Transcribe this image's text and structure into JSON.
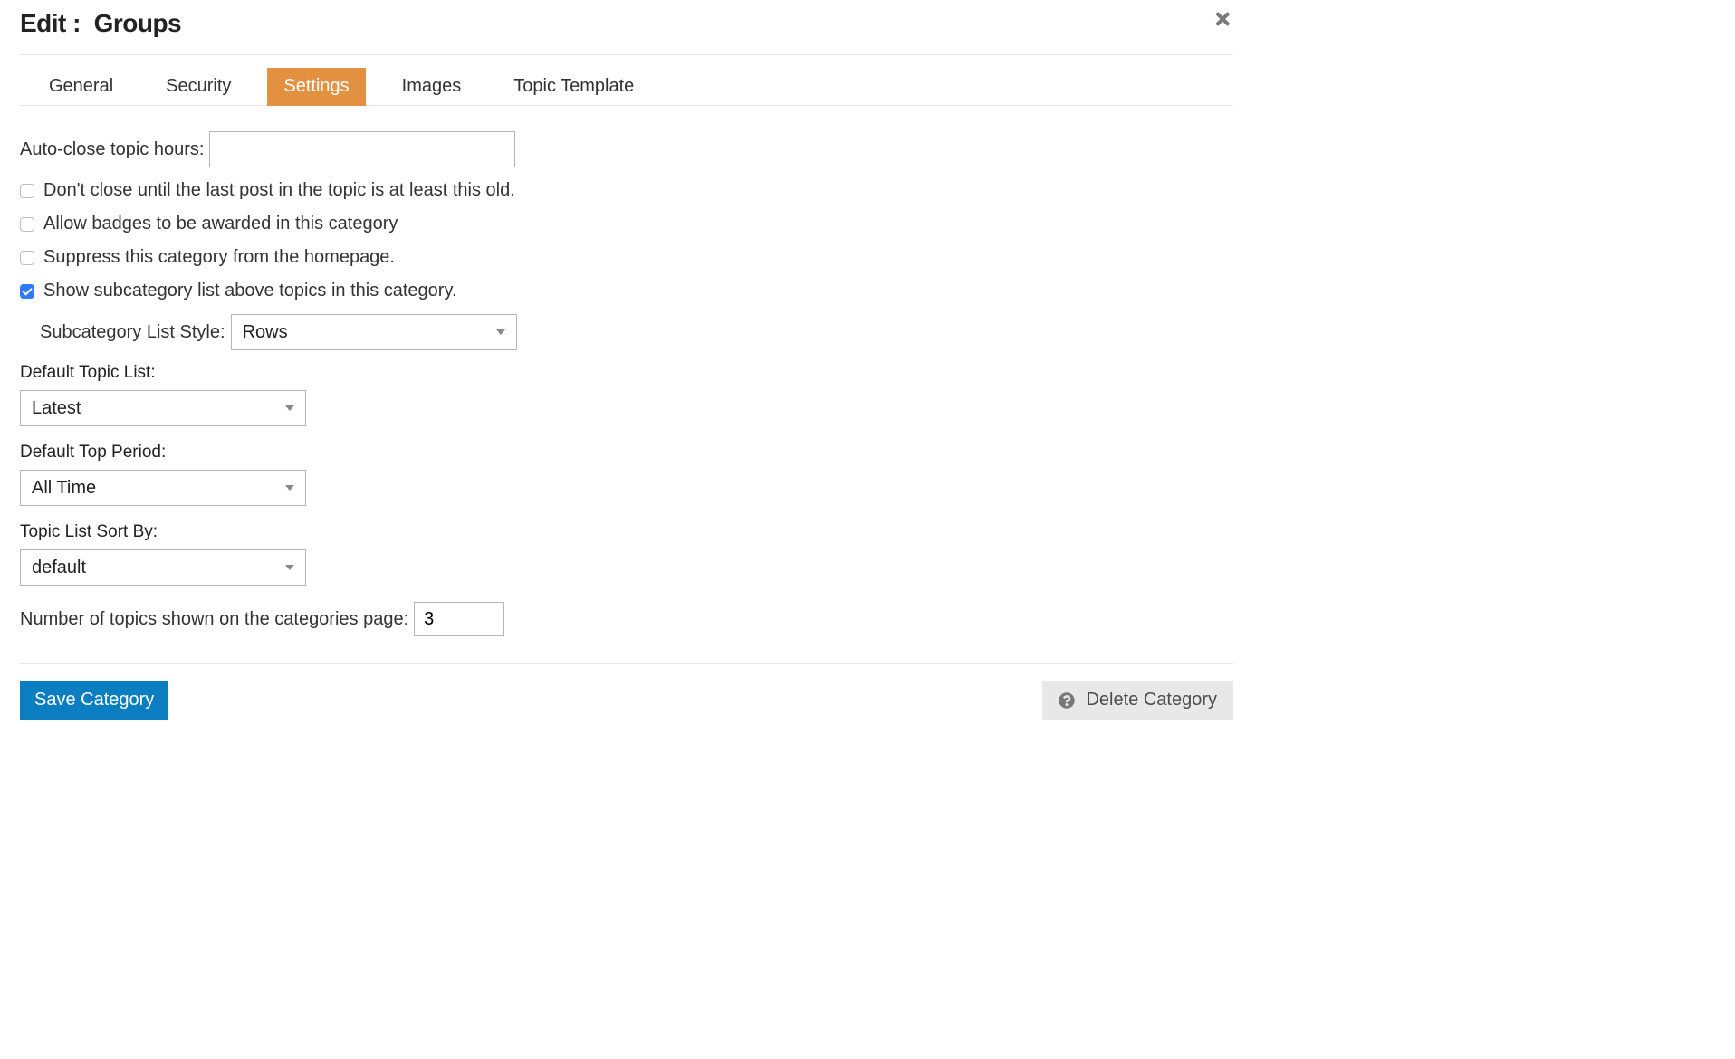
{
  "header": {
    "title_prefix": "Edit :",
    "title_subject": "Groups"
  },
  "tabs": {
    "general": "General",
    "security": "Security",
    "settings": "Settings",
    "images": "Images",
    "topic_template": "Topic Template",
    "active": "settings"
  },
  "fields": {
    "auto_close": {
      "label": "Auto-close topic hours:",
      "value": ""
    },
    "cb_dont_close": {
      "label": "Don't close until the last post in the topic is at least this old.",
      "checked": false
    },
    "cb_allow_badges": {
      "label": "Allow badges to be awarded in this category",
      "checked": false
    },
    "cb_suppress": {
      "label": "Suppress this category from the homepage.",
      "checked": false
    },
    "cb_show_subcat": {
      "label": "Show subcategory list above topics in this category.",
      "checked": true
    },
    "subcat_style": {
      "label": "Subcategory List Style:",
      "value": "Rows"
    },
    "default_topic_list": {
      "label": "Default Topic List:",
      "value": "Latest"
    },
    "default_top_period": {
      "label": "Default Top Period:",
      "value": "All Time"
    },
    "sort_by": {
      "label": "Topic List Sort By:",
      "value": "default"
    },
    "num_topics": {
      "label": "Number of topics shown on the categories page:",
      "value": "3"
    }
  },
  "footer": {
    "save": "Save Category",
    "delete": "Delete Category"
  }
}
